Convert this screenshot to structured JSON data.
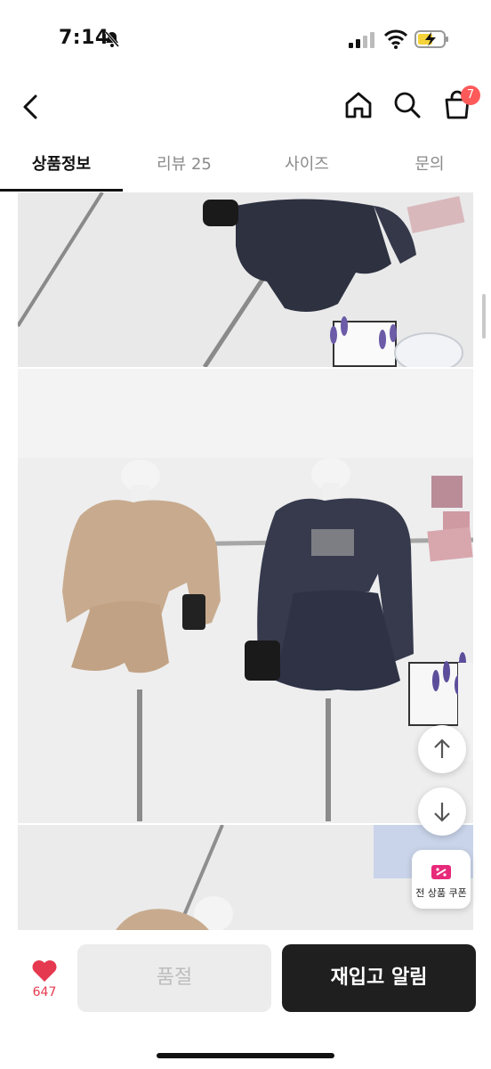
{
  "status_bar": {
    "time": "7:14"
  },
  "header": {
    "cart_count": "7"
  },
  "tabs": [
    {
      "label": "상품정보",
      "active": true
    },
    {
      "label": "리뷰 25",
      "active": false
    },
    {
      "label": "사이즈",
      "active": false
    },
    {
      "label": "문의",
      "active": false
    }
  ],
  "coupon": {
    "label": "전 상품 쿠폰"
  },
  "bottom": {
    "like_count": "647",
    "soldout_label": "품절",
    "restock_label": "재입고 알림"
  },
  "colors": {
    "accent": "#ff5a5a",
    "heart": "#e53950",
    "dark_button": "#1f1f1f"
  }
}
